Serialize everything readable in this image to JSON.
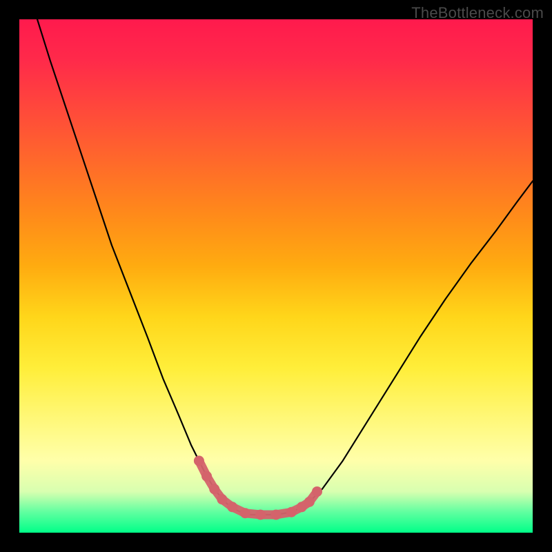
{
  "watermark": "TheBottleneck.com",
  "colors": {
    "frame": "#000000",
    "curve_stroke": "#000000",
    "marker_stroke": "#d4636b",
    "gradient_top": "#ff1a4d",
    "gradient_bottom": "#00ff88"
  },
  "chart_data": {
    "type": "line",
    "title": "",
    "xlabel": "",
    "ylabel": "",
    "xlim": [
      0,
      1
    ],
    "ylim": [
      0,
      1
    ],
    "note": "Bottleneck-style V-shaped curve plotted over a red→green vertical gradient. No numeric axes or ticks are rendered; values below describe the shape in normalized 0–1 coordinates (y=0 at bottom, y=1 at top). The pink/salmon segment highlights the near-bottom region.",
    "series": [
      {
        "name": "bottleneck_curve",
        "color": "#000000",
        "x": [
          0.035,
          0.06,
          0.09,
          0.12,
          0.15,
          0.18,
          0.215,
          0.25,
          0.28,
          0.31,
          0.335,
          0.36,
          0.38,
          0.4,
          0.42,
          0.445,
          0.47,
          0.5,
          0.53,
          0.56,
          0.59,
          0.63,
          0.68,
          0.73,
          0.78,
          0.83,
          0.88,
          0.93,
          0.97,
          1.0
        ],
        "y": [
          1.0,
          0.92,
          0.83,
          0.74,
          0.65,
          0.56,
          0.47,
          0.38,
          0.3,
          0.23,
          0.17,
          0.12,
          0.085,
          0.06,
          0.045,
          0.035,
          0.035,
          0.035,
          0.04,
          0.055,
          0.085,
          0.14,
          0.22,
          0.3,
          0.38,
          0.455,
          0.525,
          0.59,
          0.645,
          0.685
        ]
      },
      {
        "name": "highlight_segment",
        "color": "#d4636b",
        "x": [
          0.35,
          0.365,
          0.38,
          0.395,
          0.415,
          0.44,
          0.47,
          0.5,
          0.53,
          0.55,
          0.565,
          0.58
        ],
        "y": [
          0.14,
          0.11,
          0.085,
          0.065,
          0.05,
          0.038,
          0.035,
          0.035,
          0.04,
          0.05,
          0.06,
          0.08
        ]
      }
    ]
  }
}
